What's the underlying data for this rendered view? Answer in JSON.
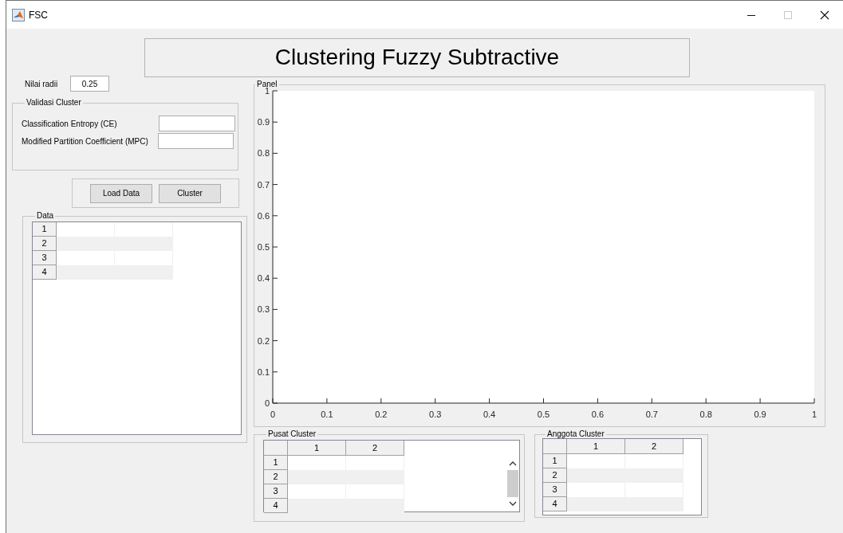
{
  "window": {
    "title": "FSC"
  },
  "header": {
    "title": "Clustering Fuzzy Subtractive"
  },
  "radius": {
    "label": "Nilai radii",
    "value": "0.25"
  },
  "validation": {
    "title": "Validasi Cluster",
    "fields": [
      {
        "label": "Classification Entropy (CE)"
      },
      {
        "label": "Modified Partition Coefficient (MPC)"
      }
    ]
  },
  "buttons": [
    "Load Data",
    "Cluster"
  ],
  "data_table": {
    "title": "Data",
    "row_headers": [
      "1",
      "2",
      "3",
      "4"
    ]
  },
  "plot": {
    "title": "Panel",
    "chart_data": {
      "type": "line",
      "xlim": [
        0,
        1
      ],
      "ylim": [
        0,
        1
      ],
      "xticks": [
        0,
        0.1,
        0.2,
        0.3,
        0.4,
        0.5,
        0.6,
        0.7,
        0.8,
        0.9,
        1
      ],
      "yticks": [
        0,
        0.1,
        0.2,
        0.3,
        0.4,
        0.5,
        0.6,
        0.7,
        0.8,
        0.9,
        1
      ]
    }
  },
  "center_table": {
    "title": "Pusat Cluster",
    "columns": [
      "1",
      "2"
    ],
    "row_headers": [
      "1",
      "2",
      "3",
      "4"
    ]
  },
  "member_table": {
    "title": "Anggota Cluster",
    "columns": [
      "1",
      "2"
    ],
    "row_headers": [
      "1",
      "2",
      "3",
      "4"
    ]
  }
}
